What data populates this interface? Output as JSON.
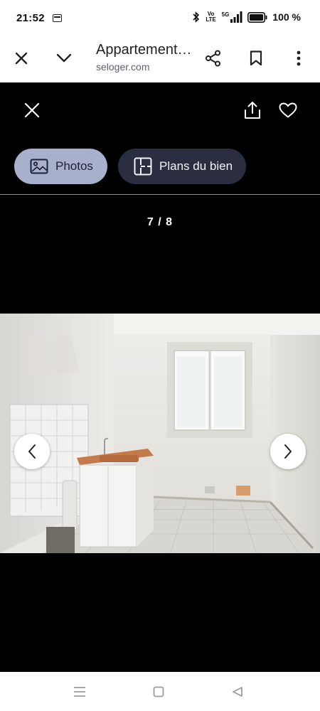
{
  "status_bar": {
    "time": "21:52",
    "network_label": "Vo LTE",
    "network_5g": "5G",
    "battery_text": "100 %",
    "icons": [
      "calendar-icon",
      "bluetooth-icon",
      "volte-icon",
      "signal-5g-icon",
      "battery-icon"
    ]
  },
  "browser": {
    "title": "Appartement…",
    "domain": "seloger.com",
    "icons": [
      "close-icon",
      "chevron-down-icon",
      "share-icon",
      "bookmark-icon",
      "more-vertical-icon"
    ]
  },
  "gallery": {
    "tabs": [
      {
        "label": "Photos",
        "icon": "image-icon",
        "selected": true
      },
      {
        "label": "Plans du bien",
        "icon": "floor-plan-icon",
        "selected": false
      }
    ],
    "counter": "7 / 8",
    "current": 7,
    "total": 8,
    "icons": [
      "close-icon",
      "upload-share-icon",
      "heart-icon",
      "chevron-left-icon",
      "chevron-right-icon"
    ],
    "photo": "empty-kitchen-photo"
  },
  "system_nav": {
    "icons": [
      "recent-apps-icon",
      "home-icon",
      "back-icon"
    ]
  },
  "colors": {
    "tab_selected_bg": "#a8b0cc",
    "tab_unselected_bg": "#2a2e40",
    "gallery_bg": "#000000"
  }
}
